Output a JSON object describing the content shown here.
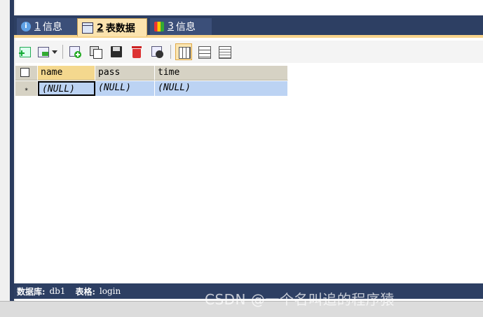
{
  "tabs": [
    {
      "num": "1",
      "label": "信息"
    },
    {
      "num": "2",
      "label": "表数据"
    },
    {
      "num": "3",
      "label": "信息"
    }
  ],
  "grid": {
    "columns": [
      "name",
      "pass",
      "time"
    ],
    "row_marker": "*",
    "rows": [
      [
        "(NULL)",
        "(NULL)",
        "(NULL)"
      ]
    ]
  },
  "status": {
    "db_label": "数据库:",
    "db_value": "db1",
    "table_label": "表格:",
    "table_value": "login"
  },
  "watermark": "CSDN @一个名叫追的程序猿",
  "colors": {
    "frame_navy": "#2d3f63",
    "tab_active": "#fbe3ae",
    "selected_row": "#bcd3f3",
    "header_highlight": "#f4d88e"
  }
}
